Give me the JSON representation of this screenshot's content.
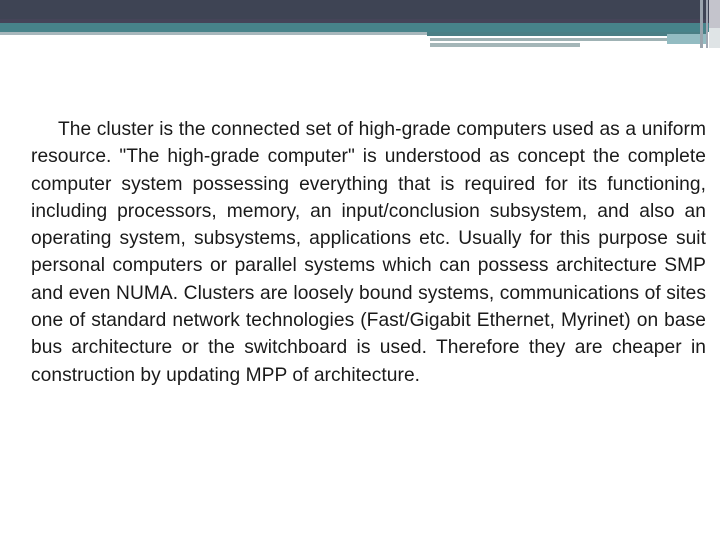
{
  "slide": {
    "header": {
      "colors": {
        "dark_band": "#3e4454",
        "teal_band": "#47838a",
        "grey_line": "#a7b7bc"
      }
    },
    "body_text": "The cluster is the connected set of high-grade computers used as a uniform resource. \"The high-grade computer\" is understood as concept the complete computer system possessing everything that is required for its functioning, including processors, memory, an input/conclusion subsystem, and also an operating system, subsystems, applications etc. Usually for this purpose suit personal computers or parallel systems which can possess architecture SMP and even NUMA. Clusters are loosely bound systems, communications of sites one of standard network technologies (Fast/Gigabit Ethernet, Myrinet) on base bus architecture or the switchboard is used. Therefore they are cheaper in construction by updating MPP of architecture."
  }
}
